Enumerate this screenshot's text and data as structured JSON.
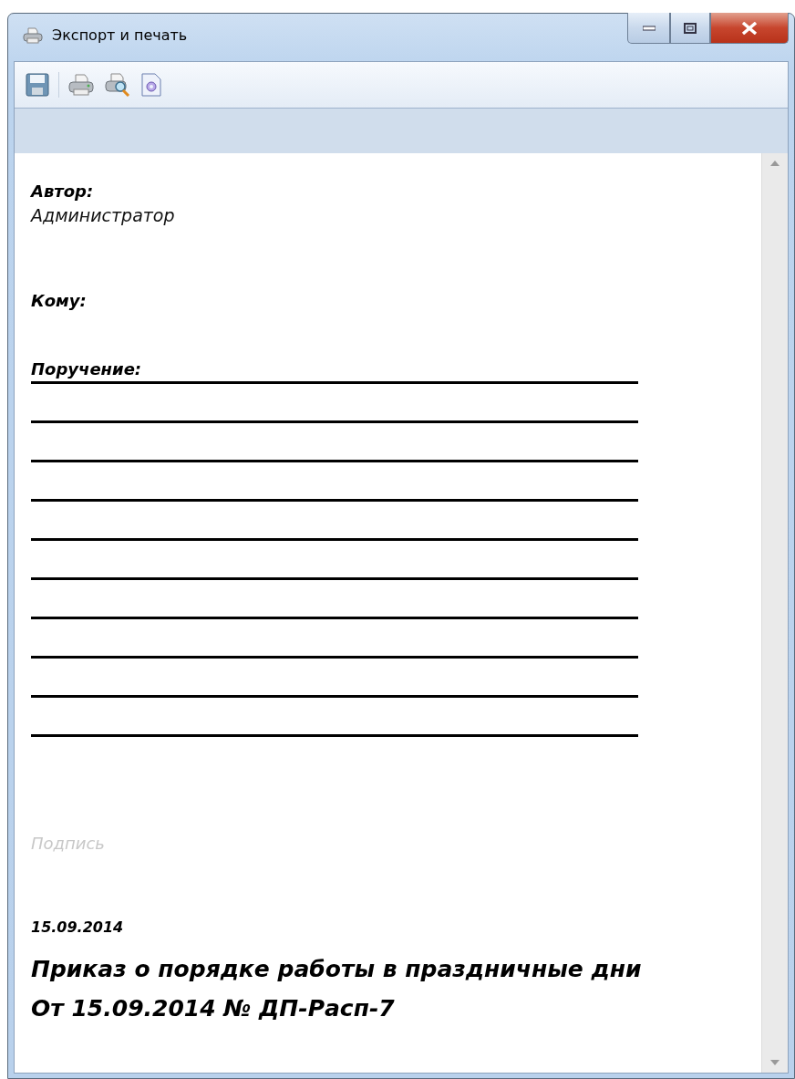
{
  "window": {
    "title": "Экспорт и печать"
  },
  "toolbar": [
    {
      "kind": "save"
    },
    {
      "kind": "separator"
    },
    {
      "kind": "print"
    },
    {
      "kind": "preview"
    },
    {
      "kind": "export"
    }
  ],
  "document": {
    "author_label": "Автор:",
    "author": "Администратор",
    "to_label": "Кому:",
    "assignment_label": "Поручение:",
    "signature": "Подпись",
    "date": "15.09.2014",
    "title": "Приказ о порядке работы в праздничные дни",
    "subtitle": "От 15.09.2014 № ДП-Расп-7"
  }
}
